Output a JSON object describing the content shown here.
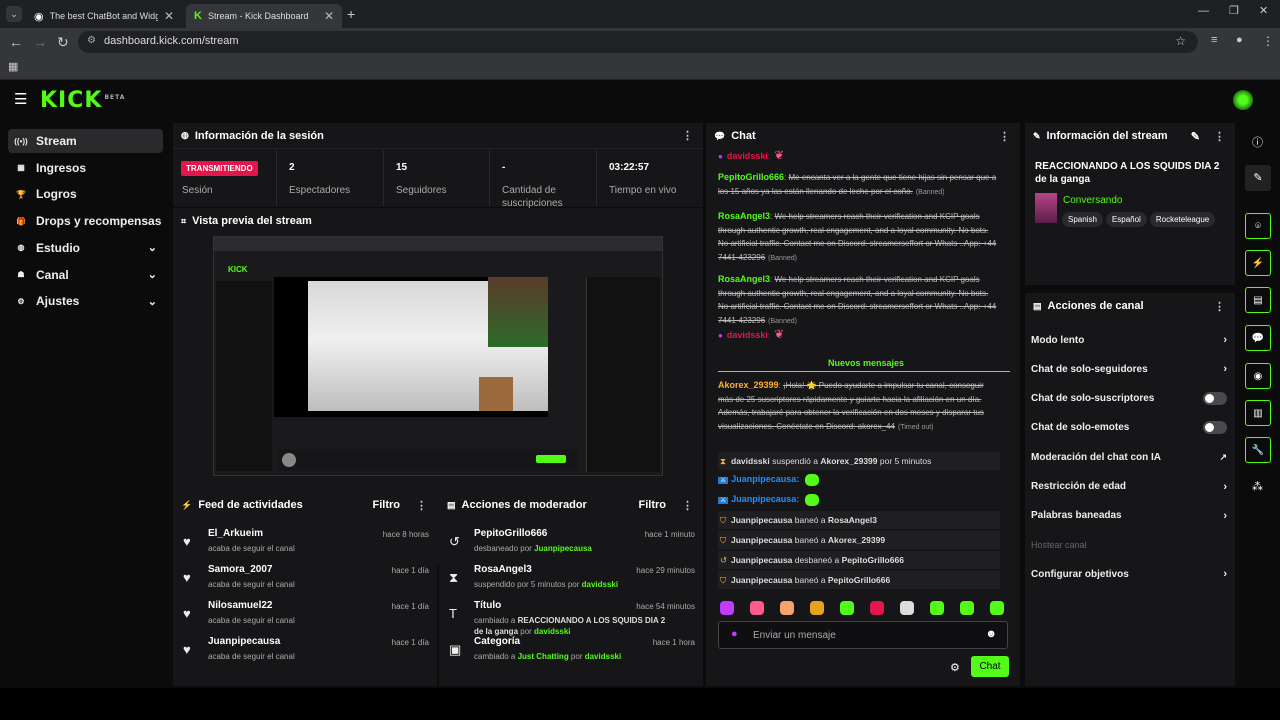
{
  "browser": {
    "tabs": [
      {
        "label": "The best ChatBot and Widgets",
        "active": false
      },
      {
        "label": "Stream - Kick Dashboard",
        "active": true
      }
    ],
    "url": "dashboard.kick.com/stream"
  },
  "app": {
    "logo": "KICK",
    "logo_badge": "BETA",
    "sidebar": [
      {
        "label": "Stream",
        "icon": "broadcast-icon",
        "active": true
      },
      {
        "label": "Ingresos",
        "icon": "income-icon"
      },
      {
        "label": "Logros",
        "icon": "trophy-icon"
      },
      {
        "label": "Drops y recompensas",
        "icon": "gift-icon"
      },
      {
        "label": "Estudio",
        "icon": "studio-icon",
        "expandable": true
      },
      {
        "label": "Canal",
        "icon": "channel-icon",
        "expandable": true
      },
      {
        "label": "Ajustes",
        "icon": "gear-icon",
        "expandable": true
      }
    ]
  },
  "session": {
    "title": "Información de la sesión",
    "status_badge": "TRANSMITIENDO",
    "status_label": "Sesión",
    "stats": [
      {
        "value": "2",
        "label": "Espectadores"
      },
      {
        "value": "15",
        "label": "Seguidores"
      },
      {
        "value": "-",
        "label": "Cantidad de suscripciones"
      },
      {
        "value": "03:22:57",
        "label": "Tiempo en vivo"
      }
    ]
  },
  "preview": {
    "title": "Vista previa del stream"
  },
  "feed": {
    "title": "Feed de actividades",
    "filter": "Filtro",
    "items": [
      {
        "name": "El_Arkueim",
        "action": "acaba de seguir el canal",
        "time": "hace 8 horas"
      },
      {
        "name": "Samora_2007",
        "action": "acaba de seguir el canal",
        "time": "hace 1 día"
      },
      {
        "name": "Nilosamuel22",
        "action": "acaba de seguir el canal",
        "time": "hace 1 día"
      },
      {
        "name": "Juanpipecausa",
        "action": "acaba de seguir el canal",
        "time": "hace 1 día"
      }
    ]
  },
  "mod": {
    "title": "Acciones de moderador",
    "filter": "Filtro",
    "items": [
      {
        "name": "PepitoGrillo666",
        "pre": "desbaneado por ",
        "user": "Juanpipecausa",
        "post": "",
        "time": "hace 1 minuto"
      },
      {
        "name": "RosaAngel3",
        "pre": "suspendido por 5 minutos por ",
        "user": "davidsski",
        "post": "",
        "time": "hace 29 minutos"
      },
      {
        "name": "Título",
        "pre": "cambiado a ",
        "user": "davidsski",
        "post": "",
        "bold": "REACCIONANDO A LOS SQUIDS DIA 2 de la ganga",
        "mid": " por ",
        "time": "hace 54 minutos"
      },
      {
        "name": "Categoría",
        "pre": "cambiado a ",
        "bold2": "Just Chatting",
        "mid": " por ",
        "user": "davidsski",
        "time": "hace 1 hora"
      }
    ]
  },
  "chat": {
    "title": "Chat",
    "messages": [
      {
        "user": "davidsski",
        "text": ":",
        "cls": "pink"
      },
      {
        "user": "PepitoGrillo666",
        "text": "Me encanta ver a la gente que tiene hijas sin pensar que a los 15 años ya las están llenando de leche por el coño.",
        "tag": "(Banned)"
      },
      {
        "user": "RosaAngel3",
        "text": "We help streamers reach their verification and KCIP goals through authentic growth, real engagement, and a loyal community. No bots. No artificial traffic. Contact me on Discord: streamerseffort or Whats ..App: +44 7441-423296",
        "tag": "(Banned)"
      },
      {
        "user": "RosaAngel3",
        "text": "We help streamers reach their verification and KCIP goals through authentic growth, real engagement, and a loyal community. No bots. No artificial traffic. Contact me on Discord: streamerseffort or Whats ..App: +44 7441-423296",
        "tag": "(Banned)"
      },
      {
        "user": "davidsski",
        "text": ":",
        "cls": "pink"
      }
    ],
    "new_messages": "Nuevos mensajes",
    "timeout_msg": {
      "user": "Akorex_29399",
      "text": "¡Hola! 🌟 Puedo ayudarte a impulsar tu canal, conseguir más de 25 suscriptores rápidamente y guiarte hacia la afiliación en un día. Además, trabajaré para obtener la verificación en dos meses y disparar tus visualizaciones. Conéctate en Discord: akorex_44",
      "tag": "(Timed out)"
    },
    "system": [
      {
        "a": "davidsski",
        "mid": " suspendió a ",
        "b": "Akorex_29399",
        "end": " por 5 minutos"
      },
      {
        "a": "Juanpipecausa",
        "mid": " baneó a ",
        "b": "RosaAngel3",
        "end": ""
      },
      {
        "a": "Juanpipecausa",
        "mid": " baneó a ",
        "b": "Akorex_29399",
        "end": ""
      },
      {
        "a": "Juanpipecausa",
        "mid": " desbaneó a ",
        "b": "PepitoGrillo666",
        "end": ""
      },
      {
        "a": "Juanpipecausa",
        "mid": " baneó a ",
        "b": "PepitoGrillo666",
        "end": ""
      }
    ],
    "juan": [
      "Juanpipecausa:",
      "Juanpipecausa:"
    ],
    "input_placeholder": "Enviar un mensaje",
    "send": "Chat"
  },
  "stream_info": {
    "title": "Información del stream",
    "stream_title": "REACCIONANDO A LOS SQUIDS DIA 2 de la ganga",
    "category": "Conversando",
    "tags": [
      "Spanish",
      "Español",
      "Rocketeleague"
    ]
  },
  "channel_actions": {
    "title": "Acciones de canal",
    "items": [
      {
        "label": "Modo lento",
        "control": "chevron"
      },
      {
        "label": "Chat de solo-seguidores",
        "control": "chevron"
      },
      {
        "label": "Chat de solo-suscriptores",
        "control": "toggle"
      },
      {
        "label": "Chat de solo-emotes",
        "control": "toggle"
      },
      {
        "label": "Moderación del chat con IA",
        "control": "external"
      },
      {
        "label": "Restricción de edad",
        "control": "chevron"
      },
      {
        "label": "Palabras baneadas",
        "control": "chevron"
      },
      {
        "label": "Hostear canal",
        "control": "none",
        "disabled": true
      },
      {
        "label": "Configurar objetivos",
        "control": "chevron"
      }
    ]
  },
  "colors": {
    "accent": "#53fc18",
    "live": "#e4144c",
    "bg": "#0b0b0c",
    "panel": "#161618"
  }
}
